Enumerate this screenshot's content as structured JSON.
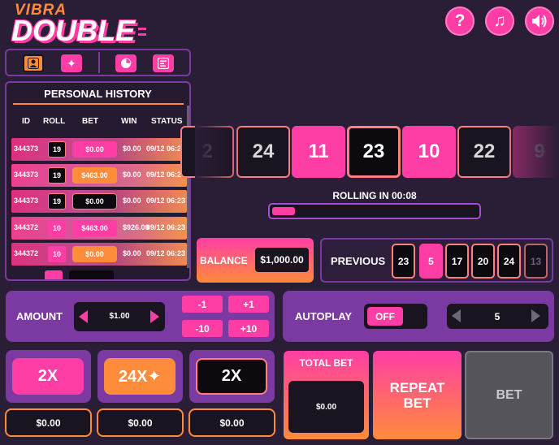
{
  "logo": {
    "top": "VIBRA",
    "main": "DOUBLE"
  },
  "top_buttons": {
    "help": "?",
    "music": "♫",
    "sound": "◀"
  },
  "history": {
    "title": "PERSONAL HISTORY",
    "columns": [
      "ID",
      "ROLL",
      "BET",
      "WIN",
      "STATUS"
    ],
    "rows": [
      {
        "id": "344373",
        "roll": "19",
        "bet": "$0.00",
        "win": "$0.00",
        "status": "09/12 06:23"
      },
      {
        "id": "344373",
        "roll": "19",
        "bet": "$463.00",
        "win": "$0.00",
        "status": "09/12 06:23"
      },
      {
        "id": "344373",
        "roll": "19",
        "bet": "$0.00",
        "win": "$0.00",
        "status": "09/12 06:23"
      },
      {
        "id": "344372",
        "roll": "10",
        "bet": "$463.00",
        "win": "$926.00",
        "status": "09/12 06:23"
      },
      {
        "id": "344372",
        "roll": "10",
        "bet": "$0.00",
        "win": "$0.00",
        "status": "09/12 06:23"
      }
    ]
  },
  "strip": {
    "tiles": [
      "2",
      "24",
      "11",
      "23",
      "10",
      "22",
      "9"
    ],
    "rolling_label": "ROLLING IN 00:08",
    "progress": 0.08
  },
  "balance": {
    "label": "BALANCE",
    "value": "$1,000.00"
  },
  "previous": {
    "label": "PREVIOUS",
    "values": [
      "23",
      "5",
      "17",
      "20",
      "24",
      "13"
    ]
  },
  "amount": {
    "label": "AMOUNT",
    "value": "$1.00",
    "adjust": [
      "-1",
      "+1",
      "-10",
      "+10"
    ]
  },
  "autoplay": {
    "label": "AUTOPLAY",
    "toggle": "OFF",
    "count": "5"
  },
  "bet_options": [
    {
      "label": "2X",
      "amount": "$0.00"
    },
    {
      "label": "24X✦",
      "amount": "$0.00"
    },
    {
      "label": "2X",
      "amount": "$0.00"
    }
  ],
  "total_bet": {
    "label": "TOTAL BET",
    "value": "$0.00"
  },
  "repeat_bet": {
    "line1": "REPEAT",
    "line2": "BET"
  },
  "bet_button": "BET",
  "colors": {
    "pink": "#ff3ea5",
    "orange": "#ff8c3a",
    "purple": "#7b3aa1",
    "dark": "#1a1320",
    "background": "#2a1d36"
  }
}
